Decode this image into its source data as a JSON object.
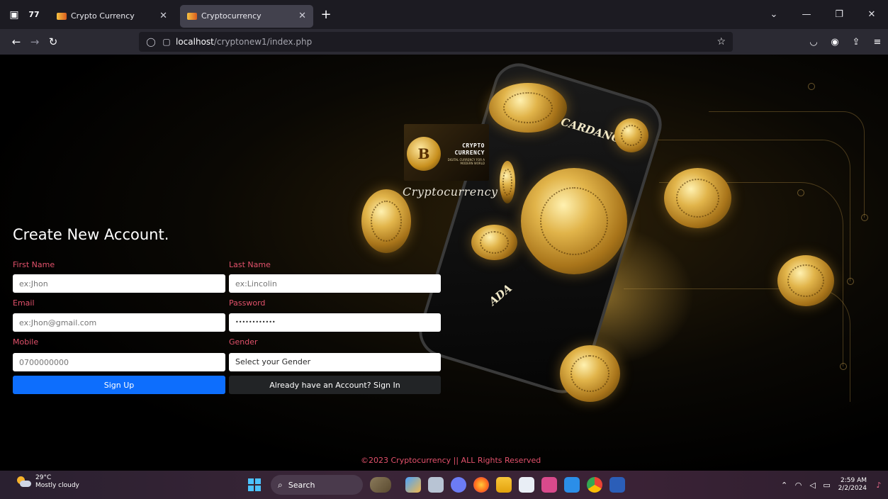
{
  "browser": {
    "tabs": [
      {
        "title": "Crypto Currency",
        "active": false
      },
      {
        "title": "Cryptocurrency",
        "active": true
      }
    ],
    "url_host": "localhost",
    "url_path": "/cryptonew1/index.php"
  },
  "logo": {
    "title_line1": "CRYPTO",
    "title_line2": "CURRENCY",
    "tagline": "DIGITAL CURRENCY FOR A MODERN WORLD",
    "brand_name": "Cryptocurrency"
  },
  "background_text": {
    "phone_label1": "CARDANO",
    "phone_label2": "ADA"
  },
  "form": {
    "title": "Create New Account.",
    "first_name_label": "First Name",
    "first_name_placeholder": "ex:Jhon",
    "last_name_label": "Last Name",
    "last_name_placeholder": "ex:Lincolin",
    "email_label": "Email",
    "email_placeholder": "ex:Jhon@gmail.com",
    "password_label": "Password",
    "password_value": "••••••••••••",
    "mobile_label": "Mobile",
    "mobile_placeholder": "0700000000",
    "gender_label": "Gender",
    "gender_selected": "Select your Gender",
    "signup_label": "Sign Up",
    "signin_label": "Already have an Account? Sign In"
  },
  "footer": "©2023 Cryptocurrency || ALL Rights Reserved",
  "taskbar": {
    "weather_temp": "29°C",
    "weather_desc": "Mostly cloudy",
    "search_label": "Search",
    "time": "2:59 AM",
    "date": "2/2/2024"
  }
}
